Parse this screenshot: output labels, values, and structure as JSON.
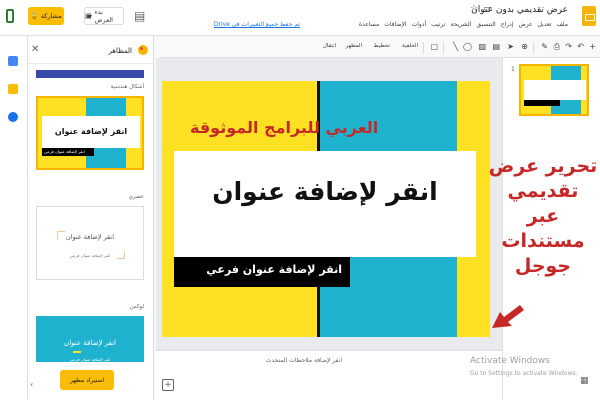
{
  "header": {
    "doc_title": "عرض تقديمي بدون عنوان",
    "last_edit": "تم حفظ جميع التغييرات في Drive",
    "menu": [
      "ملف",
      "تعديل",
      "عرض",
      "إدراج",
      "التنسيق",
      "الشريحة",
      "ترتيب",
      "أدوات",
      "الإضافات",
      "مساعدة"
    ],
    "share_label": "مشاركة",
    "present_label": "بدء العرض",
    "icons": [
      "slides-logo",
      "star-icon",
      "folder-icon",
      "lock-icon",
      "comment-icon",
      "dropdown-icon",
      "present-icon"
    ]
  },
  "toolbar": {
    "background_label": "الخلفية",
    "layout_label": "تخطيط",
    "theme_label": "المظهر",
    "transition_label": "انتقال"
  },
  "themes_panel": {
    "title": "المظاهر",
    "section_label": "أشكال هندسية",
    "themes": [
      {
        "label": "",
        "title": "انقر لإضافة عنوان",
        "subtitle": "انقر لإضافة عنوان فرعي"
      },
      {
        "label": "عصري",
        "title": "انقر لإضافة عنوان",
        "subtitle": "انقر لإضافة عنوان فرعي"
      },
      {
        "label": "لوكس",
        "title": "انقر لإضافة عنوان",
        "subtitle": "انقر لإضافة عنوان فرعي"
      }
    ],
    "import_label": "استيراد مظهر",
    "close_icon": "close-icon",
    "palette_icon": "palette-icon"
  },
  "slide": {
    "title": "انقر لإضافة عنوان",
    "subtitle": "انقر لإضافة عنوان فرعي",
    "colors": {
      "bg": "#fee123",
      "stripe": "#1fb2cf"
    }
  },
  "filmstrip": {
    "slide_number": "1"
  },
  "notes": {
    "placeholder": "انقر لإضافة ملاحظات المتحدث"
  },
  "overlay": {
    "brand": "العربي للبرامج الموثوقة",
    "side_note": "تحرير عرض تقديمي عبر مستندات جوجل"
  },
  "windows": {
    "activate_title": "Activate Windows",
    "activate_sub": "Go to Settings to activate Windows."
  }
}
